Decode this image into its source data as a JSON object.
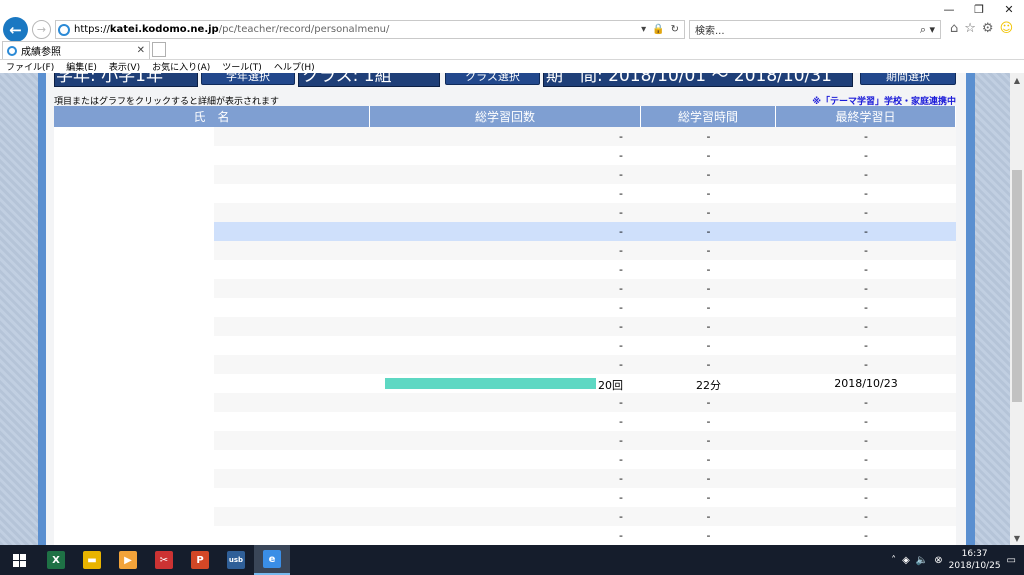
{
  "browser": {
    "url": {
      "scheme": "https://",
      "host": "katei.kodomo.ne.jp",
      "path": "/pc/teacher/record/personalmenu/"
    },
    "search_placeholder": "検索...",
    "tab_title": "成績参照",
    "menu": [
      "ファイル(F)",
      "編集(E)",
      "表示(V)",
      "お気に入り(A)",
      "ツール(T)",
      "ヘルプ(H)"
    ]
  },
  "header": {
    "grade": "学年: 小学1年",
    "grade_button": "学年選択",
    "class": "クラス: 1組",
    "class_button": "クラス選択",
    "period": "期　間: 2018/10/01 ～ 2018/10/31",
    "period_button": "期間選択"
  },
  "hint": "項目またはグラフをクリックすると詳細が表示されます",
  "note": "※「テーマ学習」学校・家庭連携中",
  "table": {
    "columns": [
      "氏　名",
      "総学習回数",
      "総学習時間",
      "最終学習日"
    ],
    "rows": [
      {
        "count": "-",
        "time": "-",
        "last": "-"
      },
      {
        "count": "-",
        "time": "-",
        "last": "-"
      },
      {
        "count": "-",
        "time": "-",
        "last": "-"
      },
      {
        "count": "-",
        "time": "-",
        "last": "-"
      },
      {
        "count": "-",
        "time": "-",
        "last": "-"
      },
      {
        "count": "-",
        "time": "-",
        "last": "-",
        "selected": true
      },
      {
        "count": "-",
        "time": "-",
        "last": "-"
      },
      {
        "count": "-",
        "time": "-",
        "last": "-"
      },
      {
        "count": "-",
        "time": "-",
        "last": "-"
      },
      {
        "count": "-",
        "time": "-",
        "last": "-"
      },
      {
        "count": "-",
        "time": "-",
        "last": "-"
      },
      {
        "count": "-",
        "time": "-",
        "last": "-"
      },
      {
        "count": "-",
        "time": "-",
        "last": "-"
      },
      {
        "count": "20回",
        "time": "22分",
        "last": "2018/10/23",
        "bar_fraction": 0.88
      },
      {
        "count": "-",
        "time": "-",
        "last": "-"
      },
      {
        "count": "-",
        "time": "-",
        "last": "-"
      },
      {
        "count": "-",
        "time": "-",
        "last": "-"
      },
      {
        "count": "-",
        "time": "-",
        "last": "-"
      },
      {
        "count": "-",
        "time": "-",
        "last": "-"
      },
      {
        "count": "-",
        "time": "-",
        "last": "-"
      },
      {
        "count": "-",
        "time": "-",
        "last": "-"
      },
      {
        "count": "-",
        "time": "-",
        "last": "-"
      }
    ]
  },
  "colors": {
    "header_blue": "#7f9fd2",
    "bar": "#5ed8c3",
    "selected_row": "#cfe0fb",
    "note": "#1c1cd9"
  },
  "taskbar": {
    "apps": [
      {
        "name": "excel-app",
        "glyph": "X",
        "color": "#1e7145"
      },
      {
        "name": "file-explorer-app",
        "glyph": "▬",
        "color": "#e8b400"
      },
      {
        "name": "media-player-app",
        "glyph": "▶",
        "color": "#f2a33a"
      },
      {
        "name": "snipping-tool-app",
        "glyph": "✂",
        "color": "#c33"
      },
      {
        "name": "powerpoint-app",
        "glyph": "P",
        "color": "#d24726"
      },
      {
        "name": "usb-app",
        "glyph": "usb",
        "color": "#2f5f98"
      },
      {
        "name": "internet-explorer-app",
        "glyph": "e",
        "color": "#3a8ee6",
        "active": true
      }
    ],
    "time": "16:37",
    "date": "2018/10/25"
  }
}
